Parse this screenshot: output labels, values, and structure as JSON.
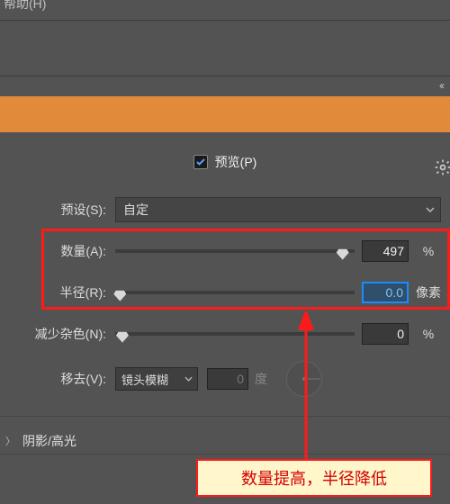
{
  "menu": {
    "help": "帮助(H)"
  },
  "collapse": "‹‹",
  "preview": {
    "label": "预览(P)",
    "checked": true
  },
  "preset": {
    "label": "预设(S):",
    "value": "自定"
  },
  "amount": {
    "label": "数量(A):",
    "value": "497",
    "unit": "%",
    "pos": 95
  },
  "radius": {
    "label": "半径(R):",
    "value": "0.0",
    "unit": "像素",
    "pos": 2
  },
  "noise": {
    "label": "减少杂色(N):",
    "value": "0",
    "unit": "%",
    "pos": 3
  },
  "remove": {
    "label": "移去(V):",
    "value": "镜头模糊",
    "degree_value": "0",
    "degree_unit": "度"
  },
  "shadows": {
    "label": "阴影/高光"
  },
  "callout": "数量提高，半径降低"
}
